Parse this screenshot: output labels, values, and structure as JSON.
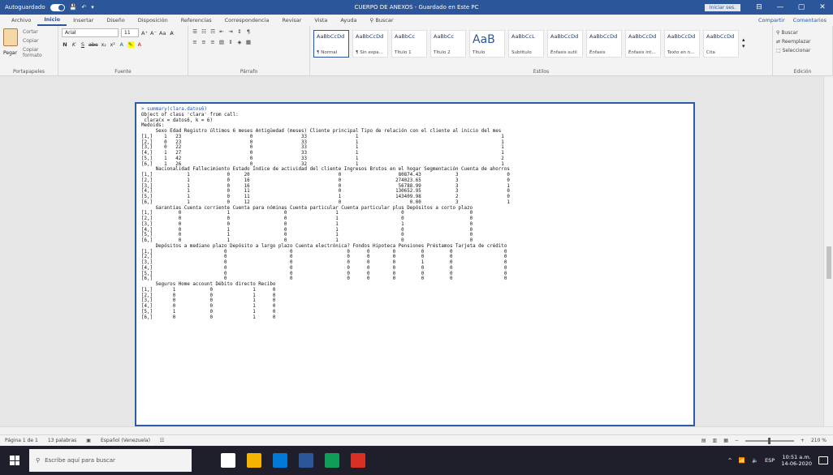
{
  "titlebar": {
    "autosave": "Autoguardado",
    "doc_title": "CUERPO DE ANEXOS - Guardado en Este PC",
    "user": "Iniciar ses.",
    "minimize": "—",
    "maximize": "▢",
    "close": "✕"
  },
  "tabs": {
    "items": [
      "Archivo",
      "Inicio",
      "Insertar",
      "Diseño",
      "Disposición",
      "Referencias",
      "Correspondencia",
      "Revisar",
      "Vista",
      "Ayuda"
    ],
    "search": "Buscar",
    "share": "Compartir",
    "comments": "Comentarios"
  },
  "ribbon": {
    "clipboard": {
      "paste": "Pegar",
      "cut": "Cortar",
      "copy": "Copiar",
      "format_painter": "Copiar formato",
      "label": "Portapapeles"
    },
    "font": {
      "family": "Arial",
      "size": "11",
      "label": "Fuente"
    },
    "paragraph": {
      "label": "Párrafo"
    },
    "styles": {
      "label": "Estilos",
      "tiles": [
        {
          "sample": "AaBbCcDd",
          "name": "¶ Normal"
        },
        {
          "sample": "AaBbCcDd",
          "name": "¶ Sin espa..."
        },
        {
          "sample": "AaBbCc",
          "name": "Título 1"
        },
        {
          "sample": "AaBbCc",
          "name": "Título 2"
        },
        {
          "sample": "AaB",
          "name": "Título"
        },
        {
          "sample": "AaBbCcL",
          "name": "Subtítulo"
        },
        {
          "sample": "AaBbCcDd",
          "name": "Énfasis sutil"
        },
        {
          "sample": "AaBbCcDd",
          "name": "Énfasis"
        },
        {
          "sample": "AaBbCcDd",
          "name": "Énfasis int..."
        },
        {
          "sample": "AaBbCcDd",
          "name": "Texto en n..."
        },
        {
          "sample": "AaBbCcDd",
          "name": "Cita"
        }
      ]
    },
    "editing": {
      "find": "Buscar",
      "replace": "Reemplazar",
      "select": "Seleccionar",
      "label": "Edición"
    }
  },
  "console": {
    "command": "> summary(clara.datos6)",
    "lines": [
      "Object of class 'clara' from call:",
      " clara(x = datos6, k = 6)",
      "Medoids:",
      "     Sexo Edad Registro últimos 6 meses Antigüedad (meses) Cliente principal Tipo de relación con el cliente al inicio del mes",
      "[1,]    1   23                        0                 33                 1                                                  1",
      "[2,]    0   23                        0                 33                 1                                                  1",
      "[3,]    0   22                        0                 33                 1                                                  1",
      "[4,]    1   27                        0                 33                 1                                                  1",
      "[5,]    1   42                        0                 33                 1                                                  2",
      "[6,]    1   26                        0                 32                 1                                                  1",
      "     Nacionalidad Fallecimiento Estado Índice de actividad del cliente Ingresos Brutos en el hogar Segmentación Cuenta de ahorros",
      "[1,]            1             0     20                               0                    80874.43            3                 0",
      "[2,]            1             0     16                               0                   274023.65            3                 0",
      "[3,]            1             0     16                               0                    56788.99            3                 1",
      "[4,]            1             0     11                               0                   130652.95            3                 0",
      "[5,]            1             0     11                               1                   143409.98            2                 0",
      "[6,]            1             0     12                               0                        0.00            3                 1",
      "     Garantías Cuenta corriente Cuenta para nóminas Cuenta particular Cuenta particular plus Depósitos a corto plazo",
      "[1,]         0                1                   0                 1                      0                       0",
      "[2,]         0                0                   0                 1                      0                       0",
      "[3,]         0                0                   0                 1                      1                       0",
      "[4,]         0                1                   0                 1                      0                       0",
      "[5,]         0                1                   0                 1                      0                       0",
      "[6,]         0                1                   0                 1                      0                       0",
      "     Depósitos a mediano plazo Depósito a largo plazo Cuenta electrónica? Fondos Hipoteca Pensiones Préstamos Tarjeta de crédito",
      "[1,]                         0                      0                   0      0        0         0         0                  0",
      "[2,]                         0                      0                   0      0        0         0         0                  0",
      "[3,]                         0                      0                   0      0        0         1         0                  0",
      "[4,]                         0                      0                   0      0        0         0         0                  0",
      "[5,]                         0                      0                   0      0        0         0         0                  0",
      "[6,]                         0                      0                   0      0        0         0         0                  0",
      "     Seguros Home account Débito directo Recibo",
      "[1,]       1            0              1      0",
      "[2,]       0            0              1      0",
      "[3,]       0            0              1      0",
      "[4,]       0            0              1      0",
      "[5,]       1            0              1      0",
      "[6,]       0            0              1      0"
    ]
  },
  "statusbar": {
    "page": "Página 1 de 1",
    "words": "13 palabras",
    "language": "Español (Venezuela)",
    "zoom": "210 %"
  },
  "taskbar": {
    "search_placeholder": "Escribe aquí para buscar",
    "lang": "ESP",
    "time": "10:51 a.m.",
    "date": "14-06-2020",
    "icon_colors": [
      "#ffffff",
      "#f4b400",
      "#0078d7",
      "#2b579a",
      "#0f9d58",
      "#d93025"
    ]
  }
}
